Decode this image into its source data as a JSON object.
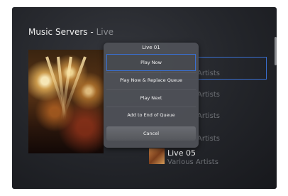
{
  "header": {
    "title": "Music Servers",
    "separator": "-",
    "subtitle": "Live"
  },
  "list": {
    "rows": [
      {
        "artist": "Artists"
      },
      {
        "artist": "Artists"
      },
      {
        "artist": "Artists"
      },
      {
        "artist": "Artists"
      },
      {
        "title": "Live 05",
        "artist": "Various Artists"
      }
    ]
  },
  "dialog": {
    "title": "Live 01",
    "items": [
      {
        "label": "Play Now"
      },
      {
        "label": "Play Now & Replace Queue"
      },
      {
        "label": "Play Next"
      },
      {
        "label": "Add to End of Queue"
      },
      {
        "label": "Cancel"
      }
    ]
  },
  "colors": {
    "accent": "#3a6fd0",
    "background": "#23252a",
    "dialog": "#4e5056"
  }
}
